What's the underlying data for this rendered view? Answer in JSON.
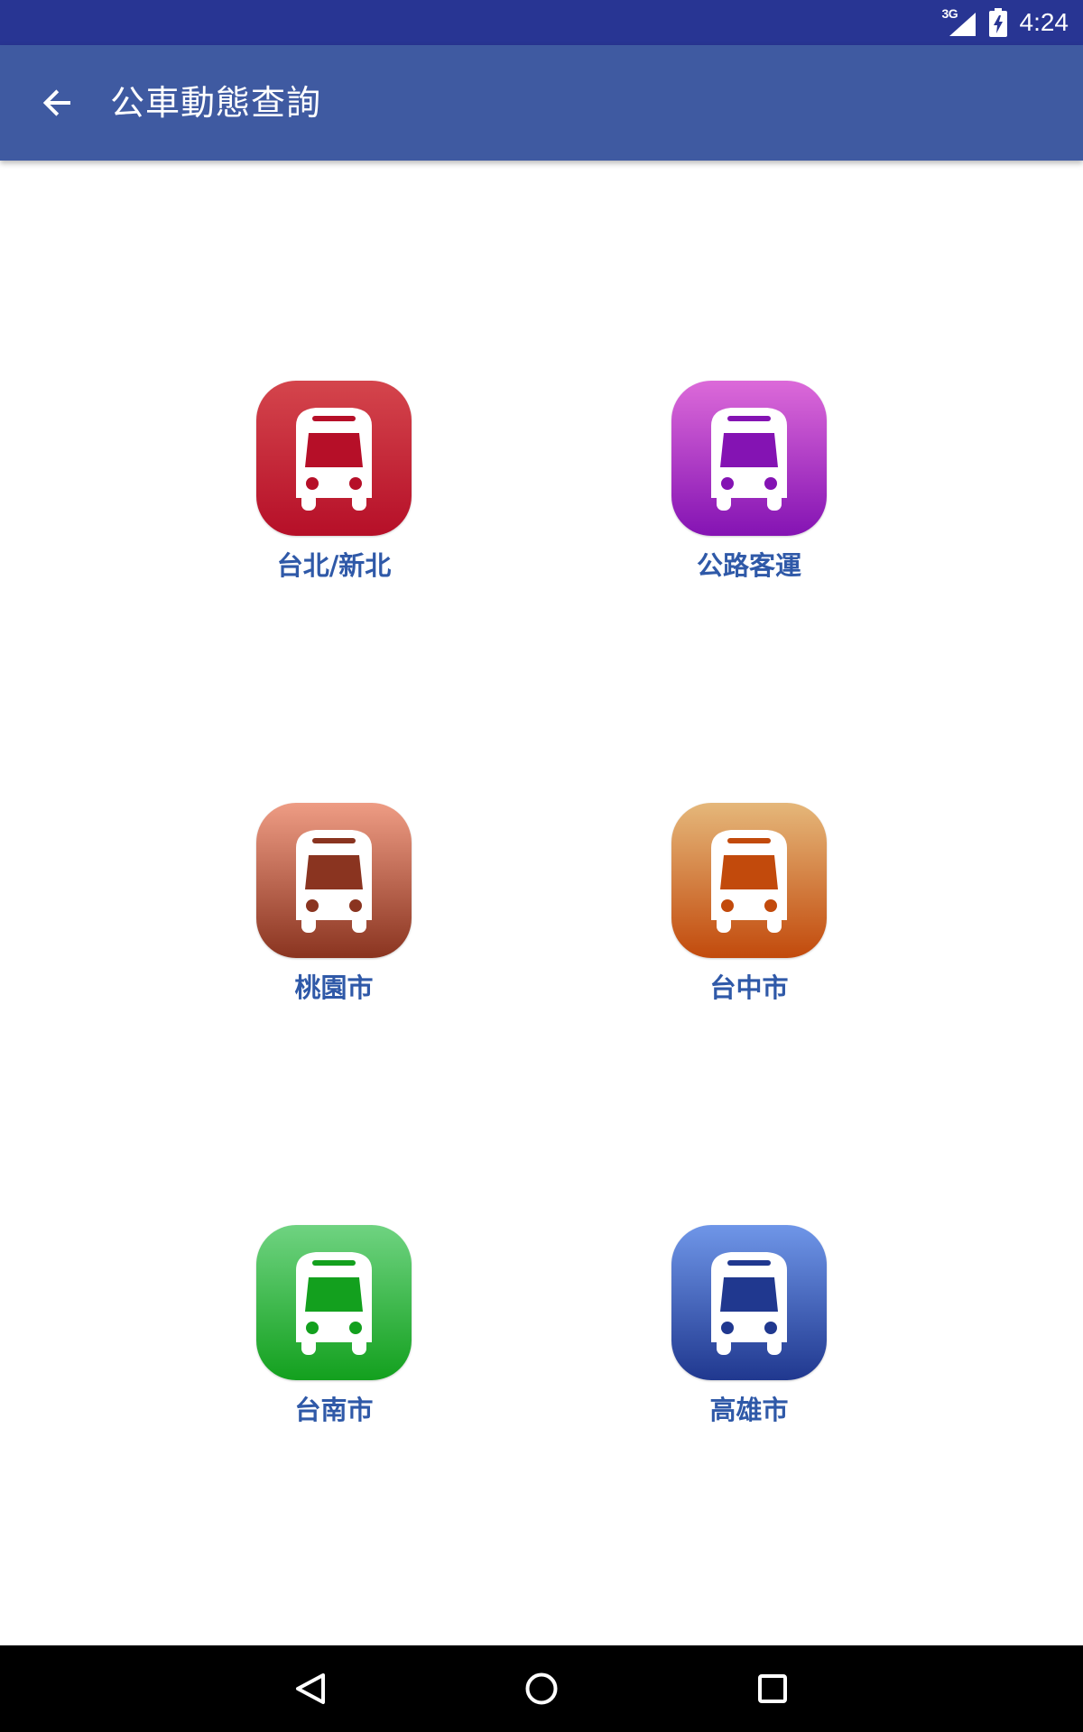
{
  "status_bar": {
    "network_type": "3G",
    "time": "4:24",
    "icons": [
      "signal-icon",
      "battery-charging-icon"
    ]
  },
  "app_bar": {
    "back_icon": "arrow-back-icon",
    "title": "公車動態查詢"
  },
  "cities": [
    {
      "label": "台北/新北",
      "icon": "bus-icon",
      "color_top": "#d4454c",
      "color_bottom": "#b60f28"
    },
    {
      "label": "公路客運",
      "icon": "bus-icon",
      "color_top": "#dc6ad9",
      "color_bottom": "#8413b3"
    },
    {
      "label": "桃園市",
      "icon": "bus-icon",
      "color_top": "#ee9c84",
      "color_bottom": "#8a3420"
    },
    {
      "label": "台中市",
      "icon": "bus-icon",
      "color_top": "#e5b77a",
      "color_bottom": "#c24a0c"
    },
    {
      "label": "台南市",
      "icon": "bus-icon",
      "color_top": "#6fd381",
      "color_bottom": "#13a01e"
    },
    {
      "label": "高雄市",
      "icon": "bus-icon",
      "color_top": "#6f96e8",
      "color_bottom": "#20388f"
    }
  ],
  "colors": {
    "status_bar": "#283593",
    "app_bar": "#3f5aa1",
    "label_text": "#2f59a8",
    "nav_bar": "#000000"
  },
  "nav_bar": {
    "icons": [
      "back-triangle-icon",
      "home-circle-icon",
      "recents-square-icon"
    ]
  }
}
